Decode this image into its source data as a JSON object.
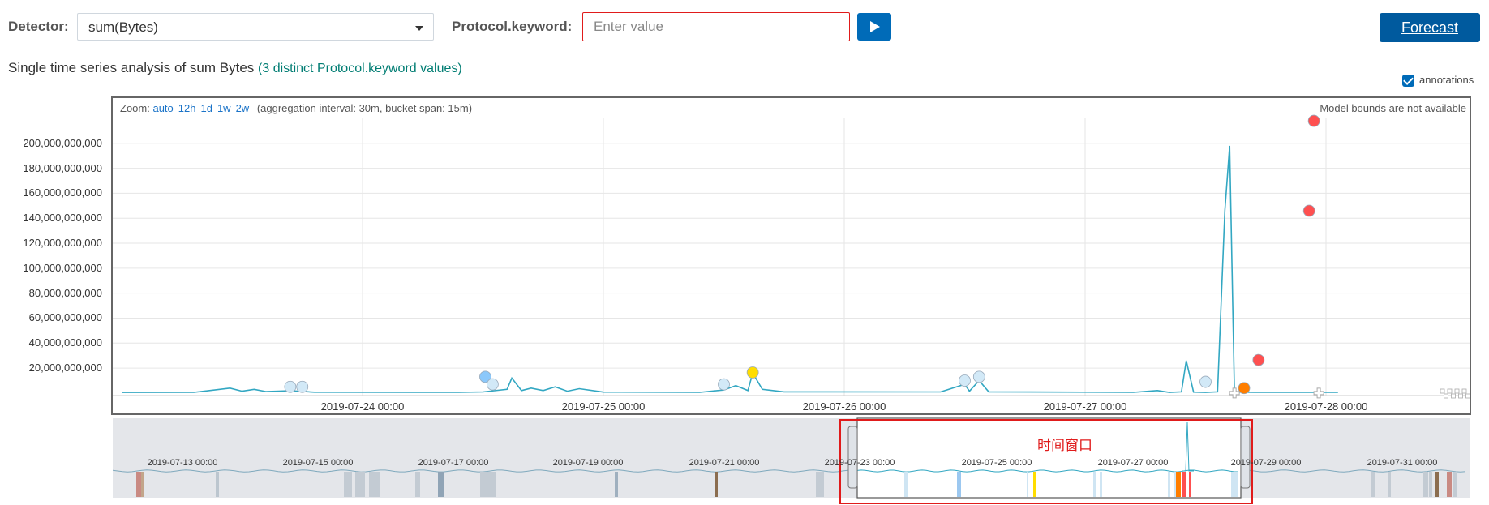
{
  "controls": {
    "detector_label": "Detector:",
    "detector_value": "sum(Bytes)",
    "protocol_label": "Protocol.keyword:",
    "protocol_placeholder": "Enter value",
    "protocol_value": "",
    "forecast_label": "Forecast"
  },
  "subtitle": {
    "text": "Single time series analysis of sum Bytes",
    "link": "(3 distinct Protocol.keyword values)"
  },
  "annotations_toggle": {
    "label": "annotations",
    "checked": true
  },
  "chart": {
    "zoom_label": "Zoom:",
    "zoom_options": [
      "auto",
      "12h",
      "1d",
      "1w",
      "2w"
    ],
    "aggregation_note": "(aggregation interval: 30m, bucket span: 15m)",
    "model_note": "Model bounds are not available"
  },
  "chart_data": {
    "type": "line",
    "y_ticks": [
      "20,000,000,000",
      "40,000,000,000",
      "60,000,000,000",
      "80,000,000,000",
      "100,000,000,000",
      "120,000,000,000",
      "140,000,000,000",
      "160,000,000,000",
      "180,000,000,000",
      "200,000,000,000"
    ],
    "x_ticks": [
      "2019-07-24 00:00",
      "2019-07-25 00:00",
      "2019-07-26 00:00",
      "2019-07-27 00:00",
      "2019-07-28 00:00"
    ],
    "ylim": [
      -2000000000,
      220000000000
    ],
    "series": [
      {
        "values": [
          [
            0,
            500000000
          ],
          [
            0.3,
            600000000
          ],
          [
            0.45,
            4000000000
          ],
          [
            0.5,
            1500000000
          ],
          [
            0.55,
            3000000000
          ],
          [
            0.6,
            1200000000
          ],
          [
            0.7,
            1800000000
          ],
          [
            0.8,
            700000000
          ],
          [
            1.4,
            600000000
          ],
          [
            1.5,
            900000000
          ],
          [
            1.6,
            3000000000
          ],
          [
            1.62,
            12000000000
          ],
          [
            1.66,
            2000000000
          ],
          [
            1.7,
            4000000000
          ],
          [
            1.75,
            2000000000
          ],
          [
            1.8,
            5000000000
          ],
          [
            1.85,
            1500000000
          ],
          [
            1.9,
            3500000000
          ],
          [
            2.0,
            800000000
          ],
          [
            2.4,
            600000000
          ],
          [
            2.5,
            2500000000
          ],
          [
            2.55,
            6000000000
          ],
          [
            2.6,
            2000000000
          ],
          [
            2.62,
            16000000000
          ],
          [
            2.66,
            3000000000
          ],
          [
            2.75,
            1000000000
          ],
          [
            3.4,
            900000000
          ],
          [
            3.5,
            7000000000
          ],
          [
            3.52,
            1500000000
          ],
          [
            3.56,
            10000000000
          ],
          [
            3.6,
            1000000000
          ],
          [
            4.2,
            600000000
          ],
          [
            4.3,
            2000000000
          ],
          [
            4.35,
            500000000
          ],
          [
            4.4,
            1000000000
          ],
          [
            4.42,
            26000000000
          ],
          [
            4.45,
            800000000
          ],
          [
            4.5,
            500000000
          ],
          [
            4.55,
            1000000000
          ],
          [
            4.58,
            146000000000
          ],
          [
            4.6,
            198000000000
          ],
          [
            4.62,
            800000000
          ],
          [
            4.7,
            600000000
          ],
          [
            5.05,
            600000000
          ]
        ]
      }
    ],
    "anomaly_markers": [
      {
        "x": 0.7,
        "y": 5000000000,
        "severity": "low"
      },
      {
        "x": 0.75,
        "y": 5000000000,
        "severity": "low"
      },
      {
        "x": 1.51,
        "y": 13000000000,
        "severity": "warning-blue"
      },
      {
        "x": 1.54,
        "y": 7000000000,
        "severity": "low"
      },
      {
        "x": 2.5,
        "y": 7000000000,
        "severity": "low"
      },
      {
        "x": 2.62,
        "y": 16500000000,
        "severity": "minor"
      },
      {
        "x": 3.5,
        "y": 10000000000,
        "severity": "low"
      },
      {
        "x": 3.56,
        "y": 13000000000,
        "severity": "low"
      },
      {
        "x": 4.5,
        "y": 9000000000,
        "severity": "low"
      },
      {
        "x": 4.66,
        "y": 4000000000,
        "severity": "major"
      },
      {
        "x": 4.72,
        "y": 26500000000,
        "severity": "critical"
      },
      {
        "x": 4.93,
        "y": 146000000000,
        "severity": "critical"
      },
      {
        "x": 4.95,
        "y": 218000000000,
        "severity": "critical"
      }
    ],
    "colors": {
      "line": "#32a7c2",
      "low": "#d2e9f7",
      "warning-blue": "#8bc8fb",
      "minor": "#ffdd00",
      "major": "#ff7e00",
      "critical": "#fe5050"
    }
  },
  "context": {
    "ticks": [
      "2019-07-13 00:00",
      "2019-07-15 00:00",
      "2019-07-17 00:00",
      "2019-07-19 00:00",
      "2019-07-21 00:00",
      "2019-07-23 00:00",
      "2019-07-25 00:00",
      "2019-07-27 00:00",
      "2019-07-29 00:00",
      "2019-07-31 00:00"
    ],
    "window_label": "时间窗口"
  }
}
